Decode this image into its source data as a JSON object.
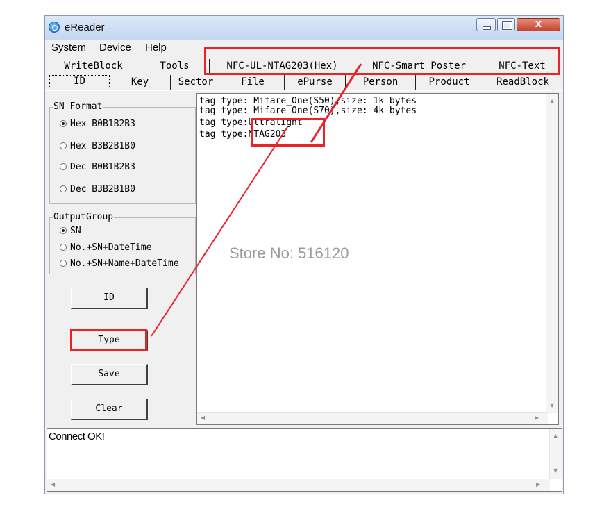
{
  "window": {
    "title": "eReader",
    "close_glyph": "X"
  },
  "menu": [
    "System",
    "Device",
    "Help"
  ],
  "tabs_row1": [
    "WriteBlock",
    "Tools",
    "NFC-UL-NTAG203(Hex)",
    "NFC-Smart Poster",
    "NFC-Text"
  ],
  "tabs_row2": [
    "ID",
    "Key",
    "Sector",
    "File",
    "ePurse",
    "Person",
    "Product",
    "ReadBlock"
  ],
  "sn_format": {
    "legend": "SN Format",
    "options": [
      "Hex B0B1B2B3",
      "Hex B3B2B1B0",
      "Dec B0B1B2B3",
      "Dec B3B2B1B0"
    ],
    "selected": 0
  },
  "output_group": {
    "legend": "OutputGroup",
    "options": [
      "SN",
      "No.+SN+DateTime",
      "No.+SN+Name+DateTime"
    ],
    "selected": 0
  },
  "buttons": {
    "id": "ID",
    "type": "Type",
    "save": "Save",
    "clear": "Clear"
  },
  "output_lines": [
    "tag type: Mifare_One(S50),size: 1k bytes",
    "tag type: Mifare_One(S70),size: 4k bytes",
    "tag type:Ultralight",
    "tag type:NTAG203"
  ],
  "log_text": "Connect OK!",
  "watermark": "Store No: 516120",
  "colors": {
    "annotation": "#e8232a",
    "watermark": "#9a9a9a",
    "window_bg": "#f0f0f0"
  },
  "icons": [
    "app-icon",
    "minimize-icon",
    "maximize-icon",
    "close-icon",
    "scroll-up-icon",
    "scroll-down-icon",
    "scroll-left-icon",
    "scroll-right-icon"
  ]
}
